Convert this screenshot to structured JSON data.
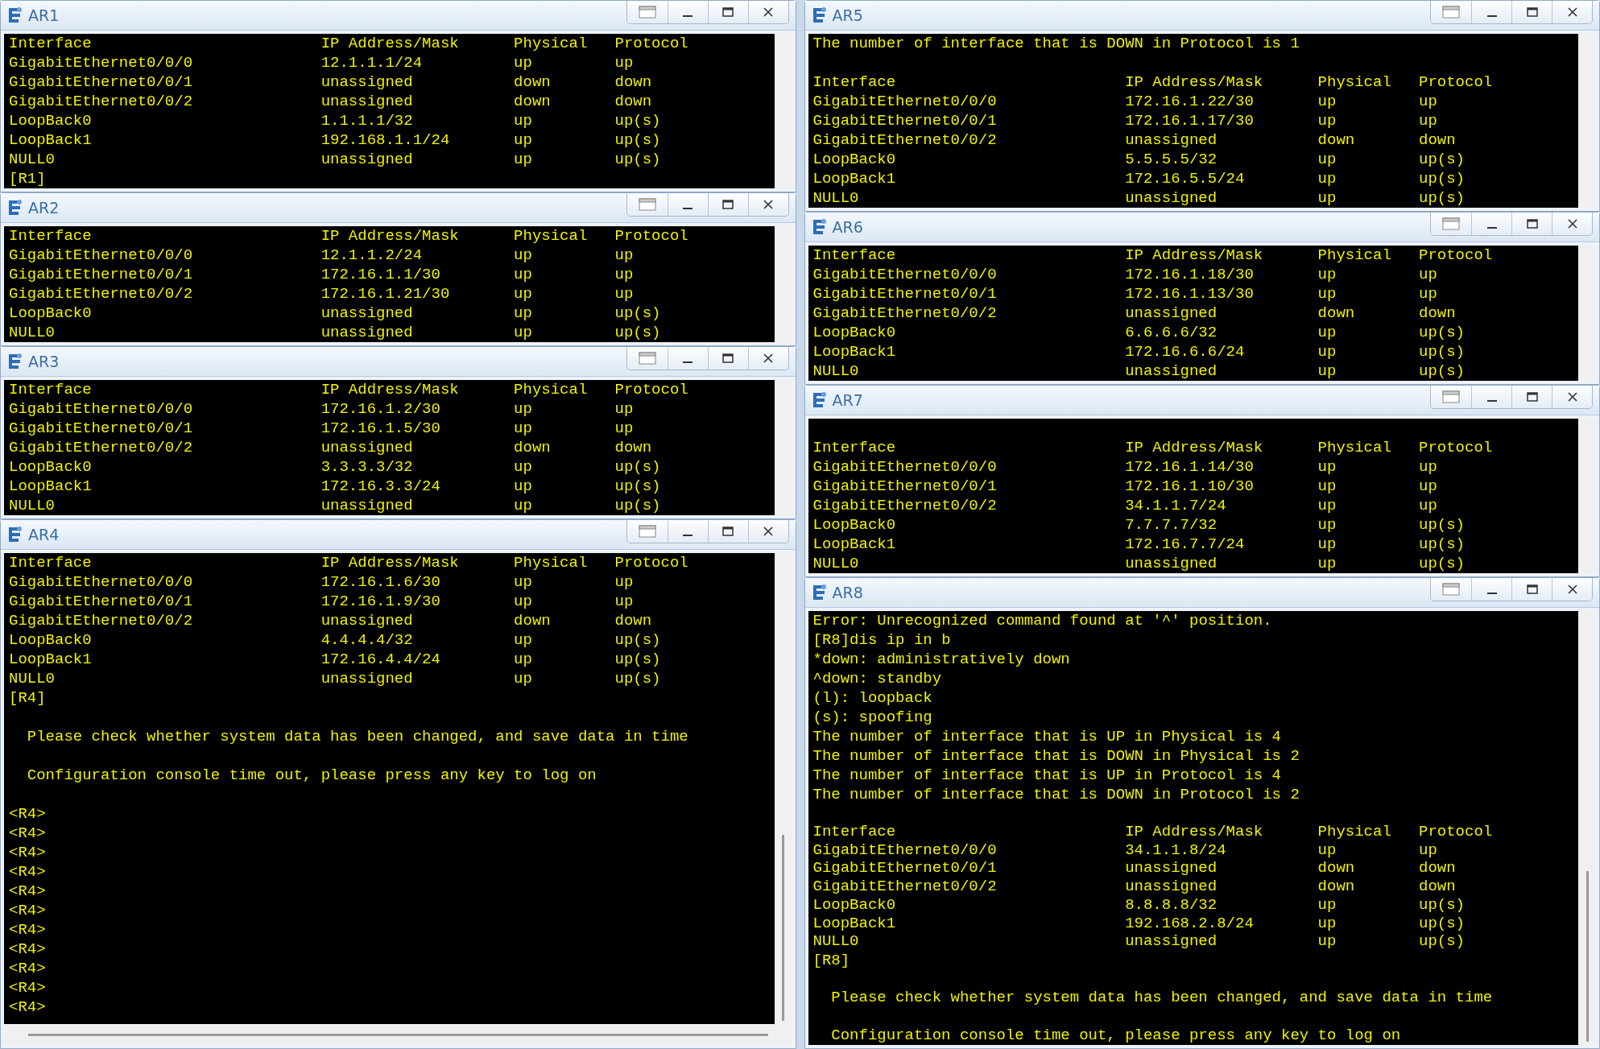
{
  "columns": [
    {
      "windows": [
        {
          "title": "AR1",
          "lines": [
            {
              "kind": "row",
              "cells": [
                "Interface",
                "IP Address/Mask",
                "Physical",
                "Protocol"
              ]
            },
            {
              "kind": "row",
              "cells": [
                "GigabitEthernet0/0/0",
                "12.1.1.1/24",
                "up",
                "up"
              ]
            },
            {
              "kind": "row",
              "cells": [
                "GigabitEthernet0/0/1",
                "unassigned",
                "down",
                "down"
              ]
            },
            {
              "kind": "row",
              "cells": [
                "GigabitEthernet0/0/2",
                "unassigned",
                "down",
                "down"
              ]
            },
            {
              "kind": "row",
              "cells": [
                "LoopBack0",
                "1.1.1.1/32",
                "up",
                "up(s)"
              ]
            },
            {
              "kind": "row",
              "cells": [
                "LoopBack1",
                "192.168.1.1/24",
                "up",
                "up(s)"
              ]
            },
            {
              "kind": "row",
              "cells": [
                "NULL0",
                "unassigned",
                "up",
                "up(s)"
              ]
            },
            {
              "kind": "text",
              "text": "[R1]"
            }
          ]
        },
        {
          "title": "AR2",
          "lines": [
            {
              "kind": "row",
              "cells": [
                "Interface",
                "IP Address/Mask",
                "Physical",
                "Protocol"
              ]
            },
            {
              "kind": "row",
              "cells": [
                "GigabitEthernet0/0/0",
                "12.1.1.2/24",
                "up",
                "up"
              ]
            },
            {
              "kind": "row",
              "cells": [
                "GigabitEthernet0/0/1",
                "172.16.1.1/30",
                "up",
                "up"
              ]
            },
            {
              "kind": "row",
              "cells": [
                "GigabitEthernet0/0/2",
                "172.16.1.21/30",
                "up",
                "up"
              ]
            },
            {
              "kind": "row",
              "cells": [
                "LoopBack0",
                "unassigned",
                "up",
                "up(s)"
              ]
            },
            {
              "kind": "row",
              "cells": [
                "NULL0",
                "unassigned",
                "up",
                "up(s)"
              ]
            }
          ]
        },
        {
          "title": "AR3",
          "lines": [
            {
              "kind": "row",
              "cells": [
                "Interface",
                "IP Address/Mask",
                "Physical",
                "Protocol"
              ]
            },
            {
              "kind": "row",
              "cells": [
                "GigabitEthernet0/0/0",
                "172.16.1.2/30",
                "up",
                "up"
              ]
            },
            {
              "kind": "row",
              "cells": [
                "GigabitEthernet0/0/1",
                "172.16.1.5/30",
                "up",
                "up"
              ]
            },
            {
              "kind": "row",
              "cells": [
                "GigabitEthernet0/0/2",
                "unassigned",
                "down",
                "down"
              ]
            },
            {
              "kind": "row",
              "cells": [
                "LoopBack0",
                "3.3.3.3/32",
                "up",
                "up(s)"
              ]
            },
            {
              "kind": "row",
              "cells": [
                "LoopBack1",
                "172.16.3.3/24",
                "up",
                "up(s)"
              ]
            },
            {
              "kind": "row",
              "cells": [
                "NULL0",
                "unassigned",
                "up",
                "up(s)"
              ]
            }
          ]
        },
        {
          "title": "AR4",
          "lines": [
            {
              "kind": "row",
              "cells": [
                "Interface",
                "IP Address/Mask",
                "Physical",
                "Protocol"
              ]
            },
            {
              "kind": "row",
              "cells": [
                "GigabitEthernet0/0/0",
                "172.16.1.6/30",
                "up",
                "up"
              ]
            },
            {
              "kind": "row",
              "cells": [
                "GigabitEthernet0/0/1",
                "172.16.1.9/30",
                "up",
                "up"
              ]
            },
            {
              "kind": "row",
              "cells": [
                "GigabitEthernet0/0/2",
                "unassigned",
                "down",
                "down"
              ]
            },
            {
              "kind": "row",
              "cells": [
                "LoopBack0",
                "4.4.4.4/32",
                "up",
                "up(s)"
              ]
            },
            {
              "kind": "row",
              "cells": [
                "LoopBack1",
                "172.16.4.4/24",
                "up",
                "up(s)"
              ]
            },
            {
              "kind": "row",
              "cells": [
                "NULL0",
                "unassigned",
                "up",
                "up(s)"
              ]
            },
            {
              "kind": "text",
              "text": "[R4]"
            },
            {
              "kind": "blank"
            },
            {
              "kind": "notice",
              "text": "Please check whether system data has been changed, and save data in time"
            },
            {
              "kind": "blank"
            },
            {
              "kind": "notice",
              "text": "Configuration console time out, please press any key to log on"
            },
            {
              "kind": "blank"
            },
            {
              "kind": "text",
              "text": "<R4>"
            },
            {
              "kind": "text",
              "text": "<R4>"
            },
            {
              "kind": "text",
              "text": "<R4>"
            },
            {
              "kind": "text",
              "text": "<R4>"
            },
            {
              "kind": "text",
              "text": "<R4>"
            },
            {
              "kind": "text",
              "text": "<R4>"
            },
            {
              "kind": "text",
              "text": "<R4>"
            },
            {
              "kind": "text",
              "text": "<R4>"
            },
            {
              "kind": "text",
              "text": "<R4>"
            },
            {
              "kind": "text",
              "text": "<R4>"
            },
            {
              "kind": "text",
              "text": "<R4>"
            }
          ]
        }
      ]
    },
    {
      "windows": [
        {
          "title": "AR5",
          "lines": [
            {
              "kind": "text",
              "text": "The number of interface that is DOWN in Protocol is 1"
            },
            {
              "kind": "blank"
            },
            {
              "kind": "row",
              "cells": [
                "Interface",
                "IP Address/Mask",
                "Physical",
                "Protocol"
              ]
            },
            {
              "kind": "row",
              "cells": [
                "GigabitEthernet0/0/0",
                "172.16.1.22/30",
                "up",
                "up"
              ]
            },
            {
              "kind": "row",
              "cells": [
                "GigabitEthernet0/0/1",
                "172.16.1.17/30",
                "up",
                "up"
              ]
            },
            {
              "kind": "row",
              "cells": [
                "GigabitEthernet0/0/2",
                "unassigned",
                "down",
                "down"
              ]
            },
            {
              "kind": "row",
              "cells": [
                "LoopBack0",
                "5.5.5.5/32",
                "up",
                "up(s)"
              ]
            },
            {
              "kind": "row",
              "cells": [
                "LoopBack1",
                "172.16.5.5/24",
                "up",
                "up(s)"
              ]
            },
            {
              "kind": "row",
              "cells": [
                "NULL0",
                "unassigned",
                "up",
                "up(s)"
              ]
            }
          ]
        },
        {
          "title": "AR6",
          "lines": [
            {
              "kind": "row",
              "cells": [
                "Interface",
                "IP Address/Mask",
                "Physical",
                "Protocol"
              ]
            },
            {
              "kind": "row",
              "cells": [
                "GigabitEthernet0/0/0",
                "172.16.1.18/30",
                "up",
                "up"
              ]
            },
            {
              "kind": "row",
              "cells": [
                "GigabitEthernet0/0/1",
                "172.16.1.13/30",
                "up",
                "up"
              ]
            },
            {
              "kind": "row",
              "cells": [
                "GigabitEthernet0/0/2",
                "unassigned",
                "down",
                "down"
              ]
            },
            {
              "kind": "row",
              "cells": [
                "LoopBack0",
                "6.6.6.6/32",
                "up",
                "up(s)"
              ]
            },
            {
              "kind": "row",
              "cells": [
                "LoopBack1",
                "172.16.6.6/24",
                "up",
                "up(s)"
              ]
            },
            {
              "kind": "row",
              "cells": [
                "NULL0",
                "unassigned",
                "up",
                "up(s)"
              ]
            }
          ]
        },
        {
          "title": "AR7",
          "lines": [
            {
              "kind": "blank"
            },
            {
              "kind": "row",
              "cells": [
                "Interface",
                "IP Address/Mask",
                "Physical",
                "Protocol"
              ]
            },
            {
              "kind": "row",
              "cells": [
                "GigabitEthernet0/0/0",
                "172.16.1.14/30",
                "up",
                "up"
              ]
            },
            {
              "kind": "row",
              "cells": [
                "GigabitEthernet0/0/1",
                "172.16.1.10/30",
                "up",
                "up"
              ]
            },
            {
              "kind": "row",
              "cells": [
                "GigabitEthernet0/0/2",
                "34.1.1.7/24",
                "up",
                "up"
              ]
            },
            {
              "kind": "row",
              "cells": [
                "LoopBack0",
                "7.7.7.7/32",
                "up",
                "up(s)"
              ]
            },
            {
              "kind": "row",
              "cells": [
                "LoopBack1",
                "172.16.7.7/24",
                "up",
                "up(s)"
              ]
            },
            {
              "kind": "row",
              "cells": [
                "NULL0",
                "unassigned",
                "up",
                "up(s)"
              ]
            }
          ]
        },
        {
          "title": "AR8",
          "lines": [
            {
              "kind": "text",
              "text": "Error: Unrecognized command found at '^' position."
            },
            {
              "kind": "text",
              "text": "[R8]dis ip in b"
            },
            {
              "kind": "text",
              "text": "*down: administratively down"
            },
            {
              "kind": "text",
              "text": "^down: standby"
            },
            {
              "kind": "text",
              "text": "(l): loopback"
            },
            {
              "kind": "text",
              "text": "(s): spoofing"
            },
            {
              "kind": "text",
              "text": "The number of interface that is UP in Physical is 4"
            },
            {
              "kind": "text",
              "text": "The number of interface that is DOWN in Physical is 2"
            },
            {
              "kind": "text",
              "text": "The number of interface that is UP in Protocol is 4"
            },
            {
              "kind": "text",
              "text": "The number of interface that is DOWN in Protocol is 2"
            },
            {
              "kind": "blank"
            },
            {
              "kind": "row",
              "cells": [
                "Interface",
                "IP Address/Mask",
                "Physical",
                "Protocol"
              ]
            },
            {
              "kind": "row",
              "cells": [
                "GigabitEthernet0/0/0",
                "34.1.1.8/24",
                "up",
                "up"
              ]
            },
            {
              "kind": "row",
              "cells": [
                "GigabitEthernet0/0/1",
                "unassigned",
                "down",
                "down"
              ]
            },
            {
              "kind": "row",
              "cells": [
                "GigabitEthernet0/0/2",
                "unassigned",
                "down",
                "down"
              ]
            },
            {
              "kind": "row",
              "cells": [
                "LoopBack0",
                "8.8.8.8/32",
                "up",
                "up(s)"
              ]
            },
            {
              "kind": "row",
              "cells": [
                "LoopBack1",
                "192.168.2.8/24",
                "up",
                "up(s)"
              ]
            },
            {
              "kind": "row",
              "cells": [
                "NULL0",
                "unassigned",
                "up",
                "up(s)"
              ]
            },
            {
              "kind": "text",
              "text": "[R8]"
            },
            {
              "kind": "blank"
            },
            {
              "kind": "notice",
              "text": "Please check whether system data has been changed, and save data in time"
            },
            {
              "kind": "blank"
            },
            {
              "kind": "notice",
              "text": "Configuration console time out, please press any key to log on"
            }
          ]
        }
      ]
    }
  ]
}
